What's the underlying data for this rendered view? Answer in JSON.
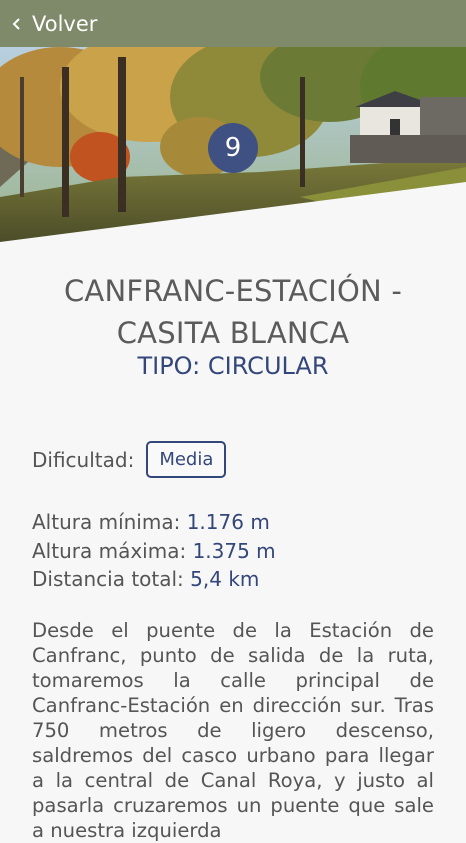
{
  "topbar": {
    "back_label": "Volver"
  },
  "hero": {
    "badge_number": "9"
  },
  "route": {
    "title": "CANFRANC-ESTACIÓN - CASITA BLANCA",
    "tipo": "TIPO: CIRCULAR"
  },
  "difficulty": {
    "label": "Dificultad:",
    "value": "Media"
  },
  "stats": {
    "min_label": "Altura mínima:",
    "min_value": "1.176 m",
    "max_label": "Altura máxima:",
    "max_value": "1.375 m",
    "dist_label": "Distancia total:",
    "dist_value": "5,4 km"
  },
  "description": "Desde el puente de la Estación de Canfranc, punto de salida de la ruta, tomaremos la calle principal de Canfranc-Estación en dirección sur. Tras 750 metros de ligero descenso, saldremos del casco urbano para llegar a la central de Canal Roya, y justo al pasarla cruzaremos un puente que sale a nuestra izquierda",
  "colors": {
    "topbar": "#7e8a6a",
    "accent": "#34477a",
    "badge": "#3f5182"
  }
}
